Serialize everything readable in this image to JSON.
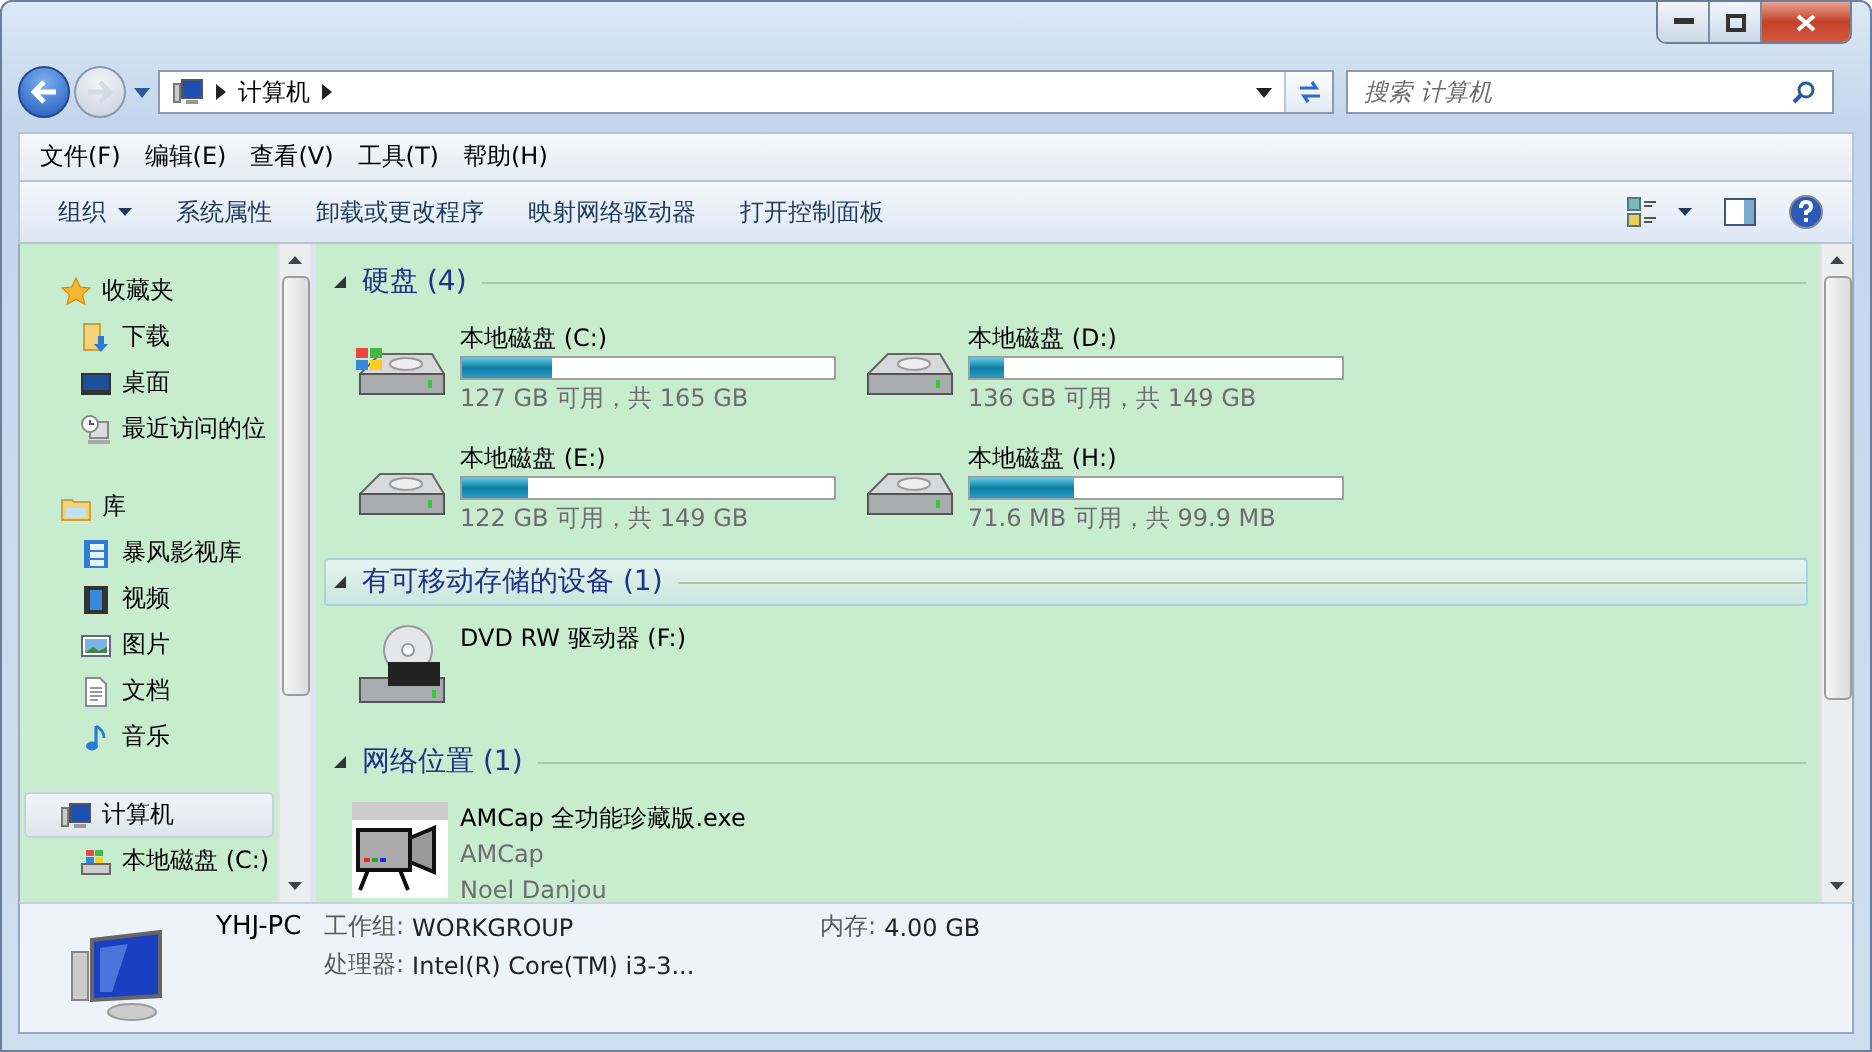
{
  "address_bar": {
    "path": [
      "计算机"
    ]
  },
  "search": {
    "placeholder": "搜索 计算机"
  },
  "menu": [
    "文件(F)",
    "编辑(E)",
    "查看(V)",
    "工具(T)",
    "帮助(H)"
  ],
  "toolbar": [
    {
      "label": "组织",
      "dropdown": true
    },
    {
      "label": "系统属性",
      "dropdown": false
    },
    {
      "label": "卸载或更改程序",
      "dropdown": false
    },
    {
      "label": "映射网络驱动器",
      "dropdown": false
    },
    {
      "label": "打开控制面板",
      "dropdown": false
    }
  ],
  "sidebar": [
    {
      "kind": "star",
      "label": "收藏夹",
      "selected": false,
      "children": [
        {
          "kind": "download",
          "label": "下载",
          "selected": false
        },
        {
          "kind": "desktop",
          "label": "桌面",
          "selected": false
        },
        {
          "kind": "recent",
          "label": "最近访问的位",
          "selected": false
        }
      ]
    },
    {
      "kind": "library",
      "label": "库",
      "selected": false,
      "children": [
        {
          "kind": "list",
          "label": "暴风影视库",
          "selected": false
        },
        {
          "kind": "video",
          "label": "视频",
          "selected": false
        },
        {
          "kind": "picture",
          "label": "图片",
          "selected": false
        },
        {
          "kind": "document",
          "label": "文档",
          "selected": false
        },
        {
          "kind": "music",
          "label": "音乐",
          "selected": false
        }
      ]
    },
    {
      "kind": "computer",
      "label": "计算机",
      "selected": true,
      "children": [
        {
          "kind": "windisk",
          "label": "本地磁盘 (C:)",
          "selected": false
        }
      ]
    }
  ],
  "sections": [
    {
      "title": "硬盘 (4)",
      "expanded": true,
      "selected": false,
      "items": [
        {
          "kind": "windisk",
          "name": "本地磁盘 (C:)",
          "level": 0.24,
          "reading": "127 GB 可用，共 165 GB"
        },
        {
          "kind": "disk",
          "name": "本地磁盘 (D:)",
          "level": 0.09,
          "reading": "136 GB 可用，共 149 GB"
        },
        {
          "kind": "disk",
          "name": "本地磁盘 (E:)",
          "level": 0.18,
          "reading": "122 GB 可用，共 149 GB"
        },
        {
          "kind": "disk",
          "name": "本地磁盘 (H:)",
          "level": 0.28,
          "reading": "71.6 MB 可用，共 99.9 MB"
        }
      ]
    },
    {
      "title": "有可移动存储的设备 (1)",
      "expanded": true,
      "selected": true,
      "items": [
        {
          "kind": "dvd",
          "name": "DVD RW 驱动器 (F:)"
        }
      ]
    },
    {
      "title": "网络位置 (1)",
      "expanded": true,
      "selected": false,
      "items": [
        {
          "kind": "app",
          "name": "AMCap 全功能珍藏版.exe",
          "lines": [
            "AMCap",
            "Noel Danjou"
          ]
        }
      ]
    }
  ],
  "details": {
    "name": "YHJ-PC",
    "fields": [
      {
        "label": "工作组:",
        "value": "WORKGROUP"
      },
      {
        "label": "内存:",
        "value": "4.00 GB"
      },
      {
        "label": "处理器:",
        "value": "Intel(R) Core(TM) i3-3..."
      }
    ]
  }
}
